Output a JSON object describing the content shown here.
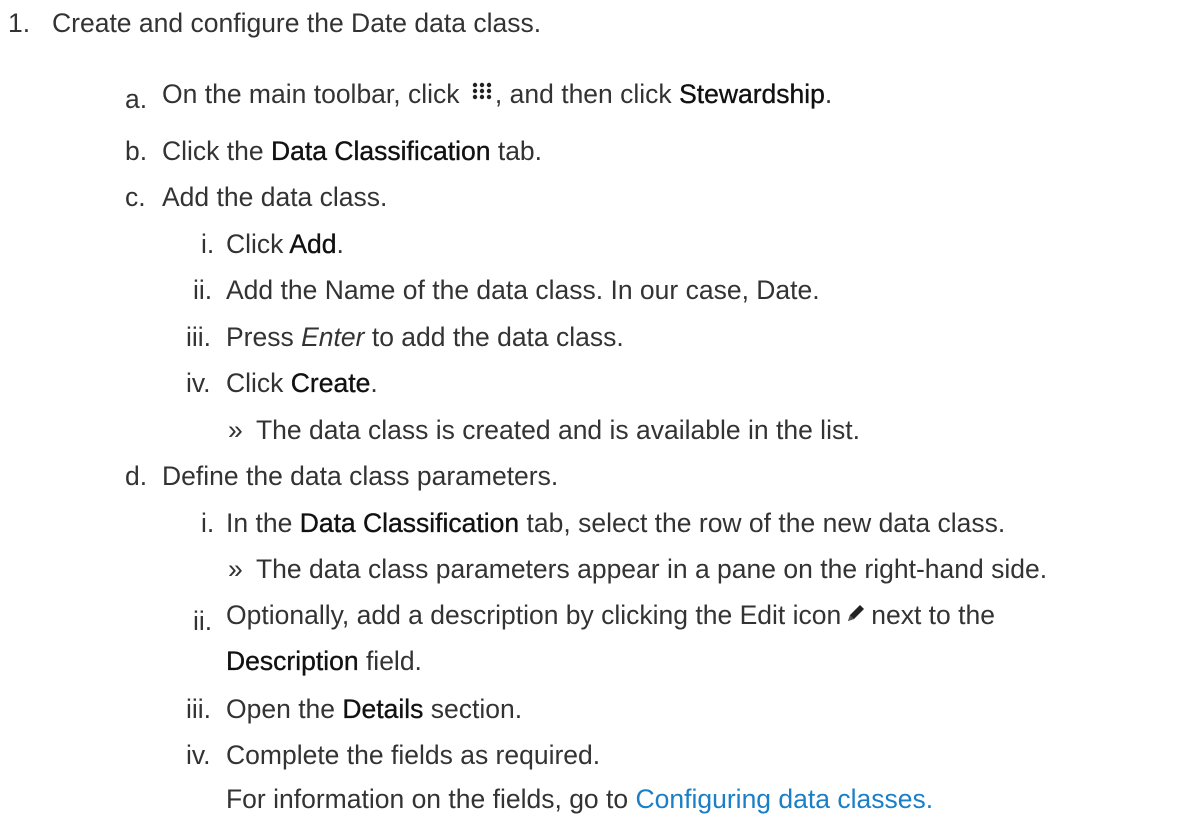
{
  "step1": {
    "marker": "1.",
    "text": "Create and configure the Date data class."
  },
  "step_a": {
    "marker": "a.",
    "pre": "On the main toolbar, click",
    "mid": ", and then click",
    "bold": "Stewardship",
    "post": "."
  },
  "step_b": {
    "marker": "b.",
    "pre": "Click the",
    "bold": "Data Classification",
    "post": "tab."
  },
  "step_c": {
    "marker": "c.",
    "text": "Add the data class.",
    "sub": [
      {
        "marker": "i.",
        "pre": "Click",
        "bold": "Add",
        "post": "."
      },
      {
        "marker": "ii.",
        "text": "Add the Name of the data class. In our case, Date."
      },
      {
        "marker": "iii.",
        "pre": "Press",
        "italic": "Enter",
        "post": "to add the data class."
      },
      {
        "marker": "iv.",
        "pre": "Click",
        "bold": "Create",
        "post": "."
      }
    ],
    "result": {
      "marker": "»",
      "text": "The data class is created and is available in the list."
    }
  },
  "step_d": {
    "marker": "d.",
    "text": "Define the data class parameters.",
    "sub_i": {
      "marker": "i.",
      "pre": "In the",
      "bold": "Data Classification",
      "post": "tab, select the row of the new data class."
    },
    "result_i": {
      "marker": "»",
      "text": "The data class parameters appear in a pane on the right-hand side."
    },
    "sub_ii": {
      "marker": "ii.",
      "pre": "Optionally, add a description by clicking the Edit icon",
      "post": "next to the",
      "bold": "Description",
      "post2": "field."
    },
    "sub_iii": {
      "marker": "iii.",
      "pre": "Open the",
      "bold": "Details",
      "post": "section."
    },
    "sub_iv": {
      "marker": "iv.",
      "text": "Complete the fields as required.",
      "info_pre": "For information on the fields, go to",
      "link": "Configuring data classes",
      "info_post": "."
    }
  },
  "icons": {
    "apps": "apps-grid-icon",
    "edit": "pencil-edit-icon"
  },
  "colors": {
    "text": "#333333",
    "link": "#1a7fc6"
  }
}
